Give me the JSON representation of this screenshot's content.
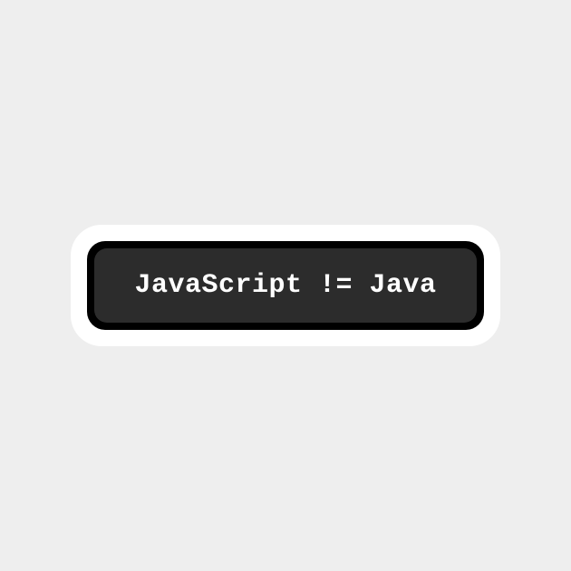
{
  "sticker": {
    "text": "JavaScript != Java"
  }
}
